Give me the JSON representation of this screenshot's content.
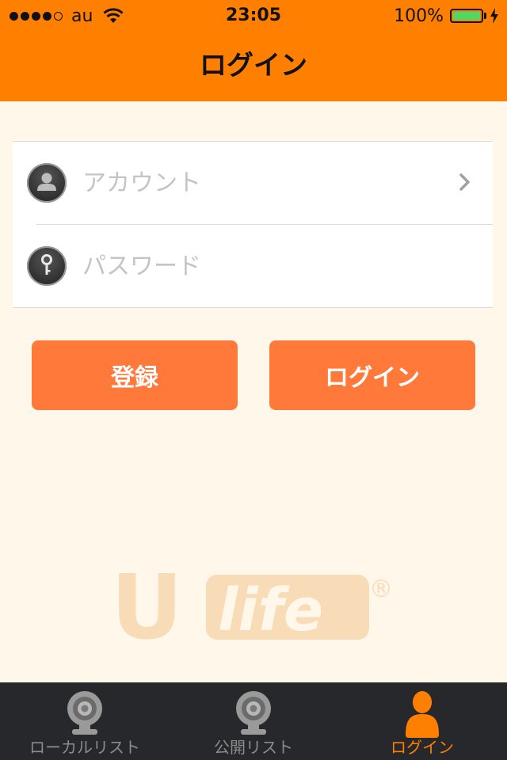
{
  "status_bar": {
    "carrier": "au",
    "time": "23:05",
    "battery": "100%",
    "battery_level": 1.0,
    "signal_bars": 4
  },
  "nav": {
    "title": "ログイン"
  },
  "form": {
    "account": {
      "placeholder": "アカウント",
      "value": "",
      "icon": "user-icon"
    },
    "password": {
      "placeholder": "パスワード",
      "value": "",
      "icon": "key-icon"
    }
  },
  "buttons": {
    "register": "登録",
    "login": "ログイン"
  },
  "logo": {
    "text_u": "U",
    "text_life": "life",
    "registered": "®"
  },
  "tab_bar": {
    "items": [
      {
        "label": "ローカルリスト",
        "icon": "webcam-icon",
        "selected": false
      },
      {
        "label": "公開リスト",
        "icon": "webcam-icon",
        "selected": false
      },
      {
        "label": "ログイン",
        "icon": "user-icon",
        "selected": true
      }
    ]
  },
  "colors": {
    "accent": "#ff8000",
    "button": "#ff7a3a",
    "background": "#fff8ea",
    "tab_bar": "#26282b",
    "tab_inactive": "#8c8c8c",
    "logo": "#f8dcb8"
  }
}
